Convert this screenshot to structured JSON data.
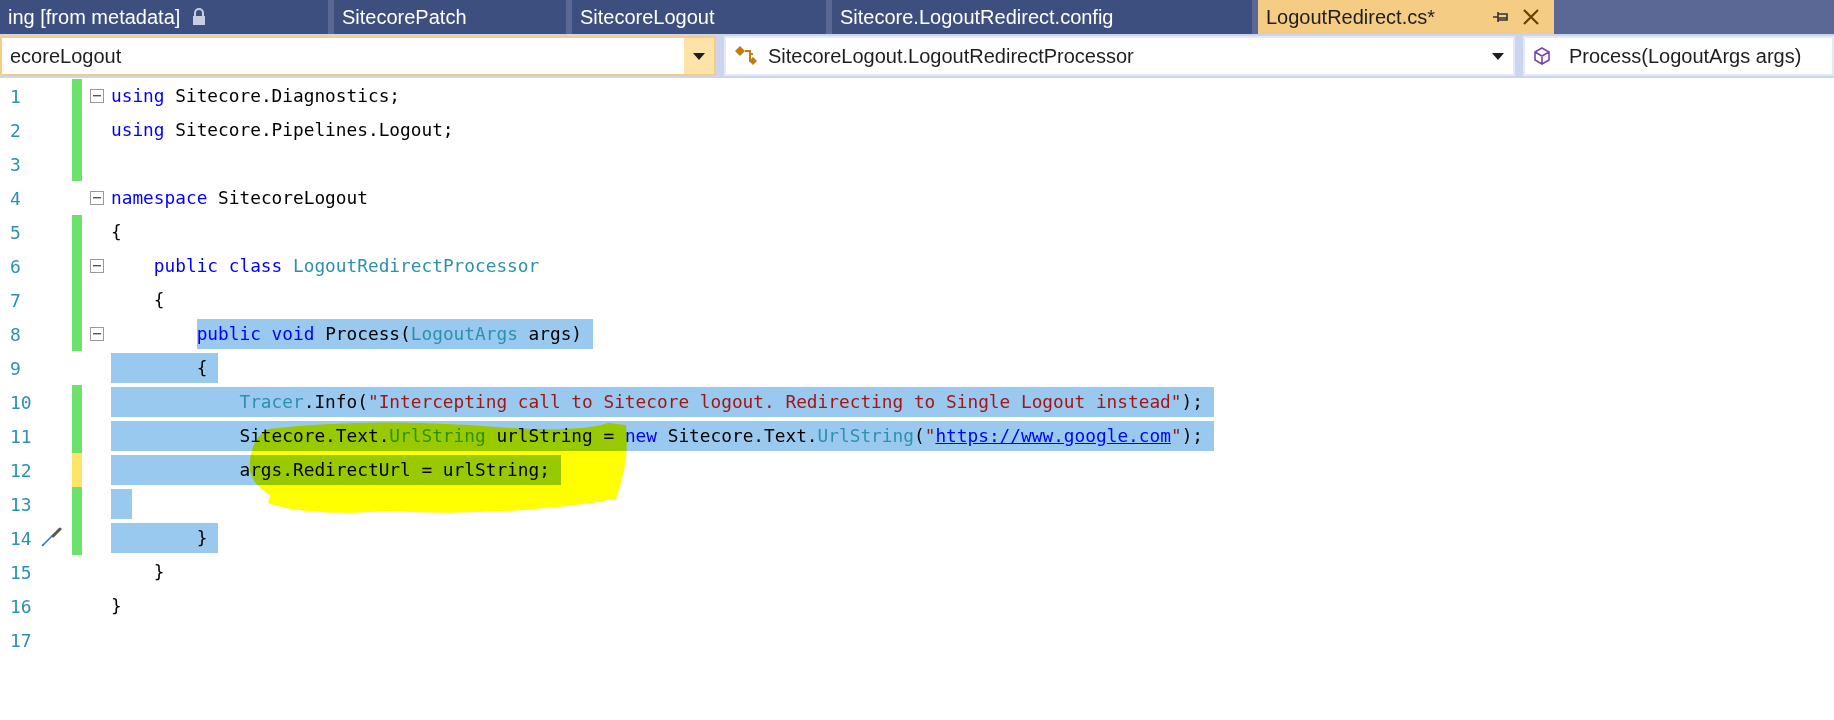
{
  "tabs": [
    {
      "label": "ing [from metadata]",
      "locked": true,
      "selected": false
    },
    {
      "label": "SitecorePatch",
      "locked": false,
      "selected": false
    },
    {
      "label": "SitecoreLogout",
      "locked": false,
      "selected": false
    },
    {
      "label": "Sitecore.LogoutRedirect.config",
      "locked": false,
      "selected": false
    },
    {
      "label": "LogoutRedirect.cs*",
      "locked": false,
      "selected": true
    }
  ],
  "navigation_bar": {
    "project": "ecoreLogout",
    "type": "SitecoreLogout.LogoutRedirectProcessor",
    "member": "Process(LogoutArgs args)"
  },
  "editor": {
    "lines": [
      {
        "number": "1",
        "changed": true,
        "unsaved": false,
        "foldable": true,
        "selected": false,
        "quick_action": false,
        "tokens": [
          {
            "kind": "keyword",
            "text": "using"
          },
          {
            "kind": "plain",
            "text": " Sitecore.Diagnostics;"
          }
        ]
      },
      {
        "number": "2",
        "changed": true,
        "unsaved": false,
        "foldable": false,
        "selected": false,
        "quick_action": false,
        "tokens": [
          {
            "kind": "keyword",
            "text": "using"
          },
          {
            "kind": "plain",
            "text": " Sitecore.Pipelines.Logout;"
          }
        ]
      },
      {
        "number": "3",
        "changed": true,
        "unsaved": false,
        "foldable": false,
        "selected": false,
        "quick_action": false
      },
      {
        "number": "4",
        "changed": false,
        "foldable": true,
        "selected": false,
        "quick_action": false,
        "tokens": [
          {
            "kind": "keyword",
            "text": "namespace"
          },
          {
            "kind": "plain",
            "text": " SitecoreLogout"
          }
        ]
      },
      {
        "number": "5",
        "changed": true,
        "unsaved": false,
        "foldable": false,
        "selected": false,
        "quick_action": false,
        "tokens": [
          {
            "kind": "plain",
            "text": "{"
          }
        ]
      },
      {
        "number": "6",
        "changed": true,
        "unsaved": false,
        "foldable": true,
        "selected": false,
        "quick_action": false,
        "tokens": [
          {
            "kind": "keyword",
            "text": "    public class"
          },
          {
            "kind": "type",
            "text": " LogoutRedirectProcessor"
          }
        ]
      },
      {
        "number": "7",
        "changed": true,
        "unsaved": false,
        "foldable": false,
        "selected": false,
        "quick_action": false,
        "tokens": [
          {
            "kind": "plain",
            "text": "    {"
          }
        ]
      },
      {
        "number": "8",
        "changed": true,
        "unsaved": false,
        "foldable": true,
        "selected": true,
        "partial_start": true,
        "quick_action": false,
        "tokens": [
          {
            "kind": "keyword",
            "text": "        public void"
          },
          {
            "kind": "plain",
            "text": " Process("
          },
          {
            "kind": "type",
            "text": "LogoutArgs"
          },
          {
            "kind": "plain",
            "text": " args)"
          }
        ]
      },
      {
        "number": "9",
        "changed": false,
        "foldable": false,
        "selected": true,
        "partial_start": false,
        "quick_action": false,
        "tokens": [
          {
            "kind": "plain",
            "text": "        {"
          }
        ]
      },
      {
        "number": "10",
        "changed": true,
        "unsaved": false,
        "foldable": false,
        "selected": true,
        "partial_start": false,
        "quick_action": false,
        "tokens": [
          {
            "kind": "type",
            "text": "            Tracer"
          },
          {
            "kind": "plain",
            "text": ".Info("
          },
          {
            "kind": "string",
            "text": "\"Intercepting call to Sitecore logout. Redirecting to Single Logout instead\""
          },
          {
            "kind": "plain",
            "text": ");"
          }
        ]
      },
      {
        "number": "11",
        "changed": true,
        "unsaved": false,
        "foldable": false,
        "selected": true,
        "partial_start": false,
        "quick_action": false,
        "tokens": [
          {
            "kind": "plain",
            "text": "            Sitecore.Text."
          },
          {
            "kind": "type",
            "text": "UrlString"
          },
          {
            "kind": "plain",
            "text": " urlString = "
          },
          {
            "kind": "keyword",
            "text": "new"
          },
          {
            "kind": "plain",
            "text": " Sitecore.Text."
          },
          {
            "kind": "type",
            "text": "UrlString"
          },
          {
            "kind": "plain",
            "text": "("
          },
          {
            "kind": "string",
            "text": "\""
          },
          {
            "kind": "link",
            "text": "https://www.google.com"
          },
          {
            "kind": "string",
            "text": "\""
          },
          {
            "kind": "plain",
            "text": ");"
          }
        ]
      },
      {
        "number": "12",
        "changed": true,
        "unsaved": true,
        "foldable": false,
        "selected": true,
        "partial_start": false,
        "quick_action": false,
        "tokens": [
          {
            "kind": "plain",
            "text": "            args.RedirectUrl = urlString;"
          }
        ]
      },
      {
        "number": "13",
        "changed": true,
        "unsaved": false,
        "foldable": false,
        "selected": true,
        "quick_action": false
      },
      {
        "number": "14",
        "changed": true,
        "unsaved": false,
        "foldable": false,
        "selected": true,
        "partial_start": false,
        "quick_action": true,
        "tokens": [
          {
            "kind": "plain",
            "text": "        }"
          }
        ]
      },
      {
        "number": "15",
        "changed": false,
        "foldable": false,
        "selected": false,
        "quick_action": false,
        "tokens": [
          {
            "kind": "plain",
            "text": "    }"
          }
        ]
      },
      {
        "number": "16",
        "changed": false,
        "foldable": false,
        "selected": false,
        "quick_action": false,
        "tokens": [
          {
            "kind": "plain",
            "text": "}"
          }
        ]
      },
      {
        "number": "17",
        "changed": false,
        "foldable": false,
        "selected": false,
        "quick_action": false
      }
    ]
  }
}
